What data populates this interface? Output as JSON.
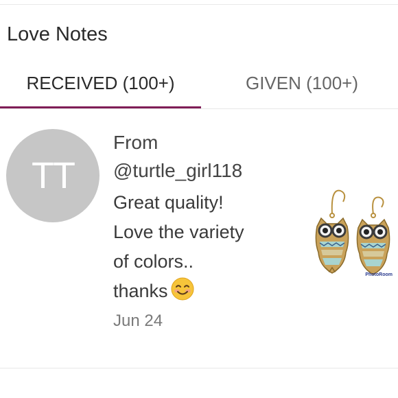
{
  "header": {
    "title": "Love Notes"
  },
  "tabs": [
    {
      "label": "RECEIVED (100+)",
      "active": true
    },
    {
      "label": "GIVEN (100+)",
      "active": false
    }
  ],
  "colors": {
    "active_tab_underline": "#7f1d57",
    "avatar_background": "#c6c6c6"
  },
  "note": {
    "avatar_initials": "TT",
    "from_label": "From",
    "username": "@turtle_girl118",
    "message_lines": [
      "Great quality!",
      "Love the variety",
      "of colors..",
      "thanks"
    ],
    "emoji": "smiling-face-icon",
    "date": "Jun 24",
    "product_image": "owl-earrings-thumbnail",
    "product_watermark": "PhotoRoom"
  }
}
